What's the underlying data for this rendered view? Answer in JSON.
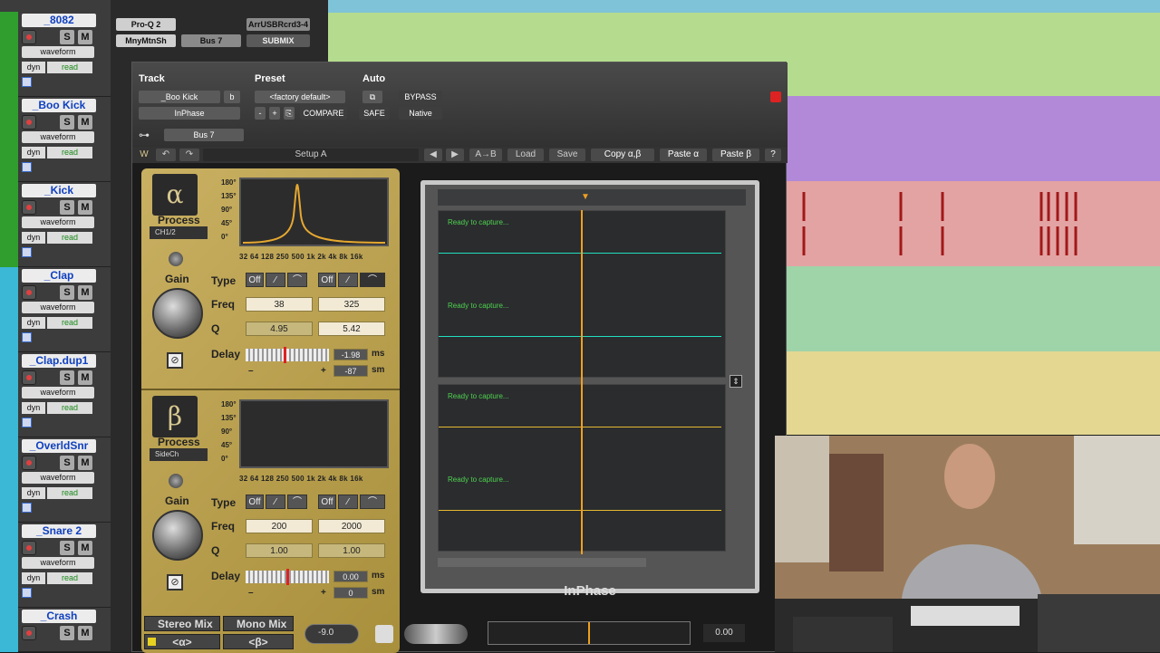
{
  "tracks": [
    {
      "name": "_8082",
      "color": "#2f9e2f",
      "view": "waveform",
      "dyn": "dyn",
      "auto": "read",
      "S": "S",
      "M": "M"
    },
    {
      "name": "_Boo Kick",
      "color": "#2f9e2f",
      "view": "waveform",
      "dyn": "dyn",
      "auto": "read",
      "S": "S",
      "M": "M"
    },
    {
      "name": "_Kick",
      "color": "#2f9e2f",
      "view": "waveform",
      "dyn": "dyn",
      "auto": "read",
      "S": "S",
      "M": "M"
    },
    {
      "name": "_Clap",
      "color": "#3bb8d6",
      "view": "waveform",
      "dyn": "dyn",
      "auto": "read",
      "S": "S",
      "M": "M"
    },
    {
      "name": "_Clap.dup1",
      "color": "#3bb8d6",
      "view": "waveform",
      "dyn": "dyn",
      "auto": "read",
      "S": "S",
      "M": "M"
    },
    {
      "name": "_OverldSnr",
      "color": "#3bb8d6",
      "view": "waveform",
      "dyn": "dyn",
      "auto": "read",
      "S": "S",
      "M": "M"
    },
    {
      "name": "_Snare 2",
      "color": "#3bb8d6",
      "view": "waveform",
      "dyn": "dyn",
      "auto": "read",
      "S": "S",
      "M": "M"
    },
    {
      "name": "_Crash",
      "color": "#3bb8d6",
      "view": "waveform",
      "dyn": "dyn",
      "auto": "read",
      "S": "S",
      "M": "M"
    }
  ],
  "inserts": {
    "i1": "Pro-Q 2",
    "i2": "MnyMtnSh",
    "i3": "Bus 7",
    "i4": "ArrUSBRcrd3-4",
    "i5": "SUBMIX"
  },
  "plugin": {
    "track_label": "Track",
    "preset_label": "Preset",
    "auto_label": "Auto",
    "track_name": "_Boo Kick",
    "track_b": "b",
    "preset_name": "<factory default>",
    "bypass": "BYPASS",
    "insert_name": "InPhase",
    "minus": "-",
    "plus": "+",
    "compare": "COMPARE",
    "safe": "SAFE",
    "native": "Native",
    "sidechain": "Bus 7"
  },
  "toolbar": {
    "setup": "Setup A",
    "ab": "A→B",
    "load": "Load",
    "save": "Save",
    "copy": "Copy α,β",
    "paste_a": "Paste α",
    "paste_b": "Paste β",
    "help": "?"
  },
  "alpha": {
    "symbol": "α",
    "process": "Process",
    "process_value": "CH1/2",
    "gain": "Gain",
    "type": "Type",
    "freq": "Freq",
    "q": "Q",
    "delay": "Delay",
    "off1": "Off",
    "off2": "Off",
    "freq1": "38",
    "freq2": "325",
    "q1": "4.95",
    "q2": "5.42",
    "delay_ms": "-1.98",
    "delay_sm": "-87",
    "ms": "ms",
    "sm": "sm",
    "minus": "–",
    "plus": "+"
  },
  "beta": {
    "symbol": "β",
    "process": "Process",
    "process_value": "SideCh",
    "gain": "Gain",
    "type": "Type",
    "freq": "Freq",
    "q": "Q",
    "delay": "Delay",
    "off1": "Off",
    "off2": "Off",
    "freq1": "200",
    "freq2": "2000",
    "q1": "1.00",
    "q2": "1.00",
    "delay_ms": "0.00",
    "delay_sm": "0",
    "ms": "ms",
    "sm": "sm",
    "minus": "–",
    "plus": "+"
  },
  "db_axis": [
    "180°",
    "135°",
    "90°",
    "45°",
    "0°"
  ],
  "freq_axis": "32  64 128 250 500  1k  2k  4k  8k 16k",
  "display": {
    "ready1": "Ready to capture...",
    "ready2": "Ready to capture...",
    "ready3": "Ready to capture...",
    "ready4": "Ready to capture..."
  },
  "product": "InPhase",
  "bottom": {
    "stereo": "Stereo Mix",
    "mono": "Mono Mix",
    "alpha_sel": "<α>",
    "beta_sel": "<β>",
    "gain_value": "-9.0",
    "output_value": "0.00"
  },
  "colors": {
    "alpha_line": "#22e0c0",
    "beta_line": "#e6b830",
    "cursor": "#f0a020",
    "gold": "#c9b062"
  }
}
